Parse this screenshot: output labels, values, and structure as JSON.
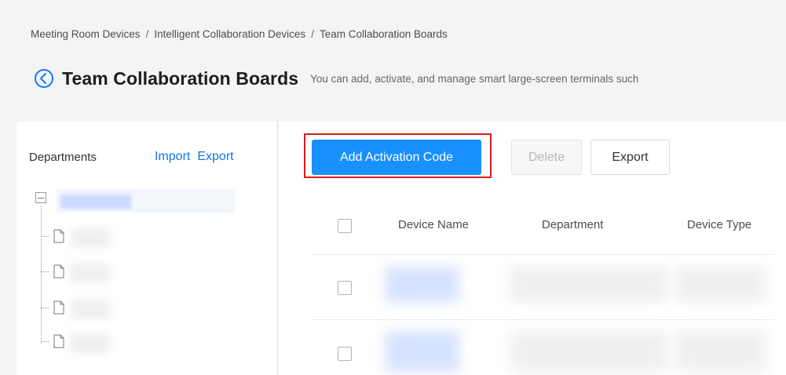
{
  "breadcrumb": {
    "items": [
      "Meeting Room Devices",
      "Intelligent Collaboration Devices",
      "Team Collaboration Boards"
    ],
    "separator": "/"
  },
  "header": {
    "back_icon": "chevron-left-circle-icon",
    "title": "Team Collaboration Boards",
    "description": "You can add, activate, and manage smart large-screen terminals such"
  },
  "sidebar": {
    "title": "Departments",
    "import_label": "Import",
    "export_label": "Export",
    "tree": {
      "root_icon": "collapse-box-icon",
      "child_icon": "file-icon",
      "child_count": 4
    }
  },
  "toolbar": {
    "add_activation_code_label": "Add Activation Code",
    "delete_label": "Delete",
    "export_label": "Export"
  },
  "table": {
    "columns": [
      "Device Name",
      "Department",
      "Device Type"
    ],
    "row_count_visible": 2
  },
  "colors": {
    "primary": "#1890ff",
    "link": "#1473e6",
    "highlight": "#d91b1b",
    "background": "#f4f4f5"
  }
}
